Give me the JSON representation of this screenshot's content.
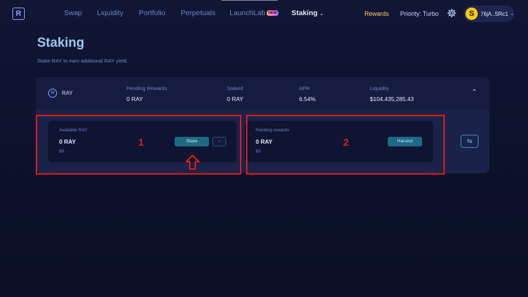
{
  "nav": {
    "items": [
      {
        "label": "Swap"
      },
      {
        "label": "Liquidity"
      },
      {
        "label": "Portfolio"
      },
      {
        "label": "Perpetuals"
      },
      {
        "label": "LaunchLab",
        "badge": "NEW"
      },
      {
        "label": "Staking",
        "active": true
      }
    ],
    "rewards": "Rewards",
    "priority": "Priority: Turbo",
    "wallet_address": "76jA..SRc1"
  },
  "page": {
    "title": "Staking",
    "subtitle": "Stake RAY to earn additional RAY yield."
  },
  "pool": {
    "token": "RAY",
    "columns": [
      {
        "label": "Pending Rewards",
        "value": "0 RAY"
      },
      {
        "label": "Staked",
        "value": "0 RAY"
      },
      {
        "label": "APR",
        "value": "6.54%"
      },
      {
        "label": "Liquidity",
        "value": "$104,435,285.43"
      }
    ],
    "available": {
      "label": "Available RAY",
      "value": "0 RAY",
      "usd": "$0",
      "stake_label": "Stake",
      "minus_label": "-"
    },
    "pending": {
      "label": "Pending rewards",
      "value": "0 RAY",
      "usd": "$0",
      "harvest_label": "Harvest"
    }
  },
  "annotations": {
    "box1_number": "1",
    "box2_number": "2",
    "highlight_color": "#e01b1b"
  },
  "colors": {
    "accent": "#1e6a86",
    "title": "#9ec7ef",
    "rewards": "#ffd166"
  }
}
